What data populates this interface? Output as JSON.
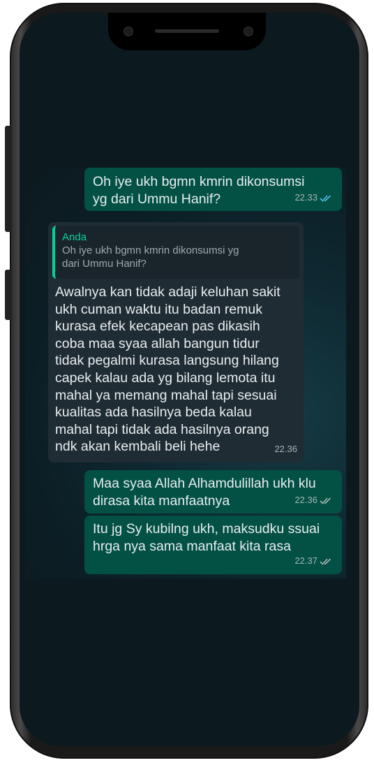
{
  "chat": {
    "messages": [
      {
        "direction": "outgoing",
        "text": "Oh iye ukh bgmn kmrin dikonsumsi\nyg dari Ummu Hanif?",
        "time": "22.33",
        "status": "read",
        "tick_color": "#53bdeb"
      },
      {
        "direction": "incoming",
        "quote_author": "Anda",
        "quote_text": "Oh iye ukh bgmn kmrin dikonsumsi yg\ndari Ummu Hanif?",
        "text": "Awalnya kan tidak adaji keluhan sakit\nukh cuman waktu itu badan remuk\nkurasa efek kecapean pas dikasih\ncoba maa syaa allah bangun tidur\ntidak pegalmi kurasa langsung hilang\ncapek kalau ada yg bilang lemota itu\nmahal ya memang mahal tapi sesuai\nkualitas ada hasilnya beda kalau\nmahal tapi tidak ada hasilnya orang\nndk akan kembali beli hehe",
        "time": "22.36"
      },
      {
        "direction": "outgoing",
        "text": "Maa syaa Allah Alhamdulillah ukh klu\ndirasa kita manfaatnya",
        "time": "22.36",
        "status": "delivered",
        "tick_color": "#a6b5b3"
      },
      {
        "direction": "outgoing",
        "text": "Itu jg Sy kubilng ukh, maksudku ssuai\nhrga nya sama manfaat kita rasa",
        "time": "22.37",
        "status": "delivered",
        "tick_color": "#a6b5b3"
      }
    ]
  },
  "colors": {
    "outgoing_bubble": "#025144",
    "incoming_bubble": "#1f2c33",
    "quote_accent": "#06cf9c",
    "chat_background": "#0c1a1f"
  },
  "icons": {
    "read_receipt": "double-check-icon",
    "delivered_receipt": "double-check-icon"
  }
}
